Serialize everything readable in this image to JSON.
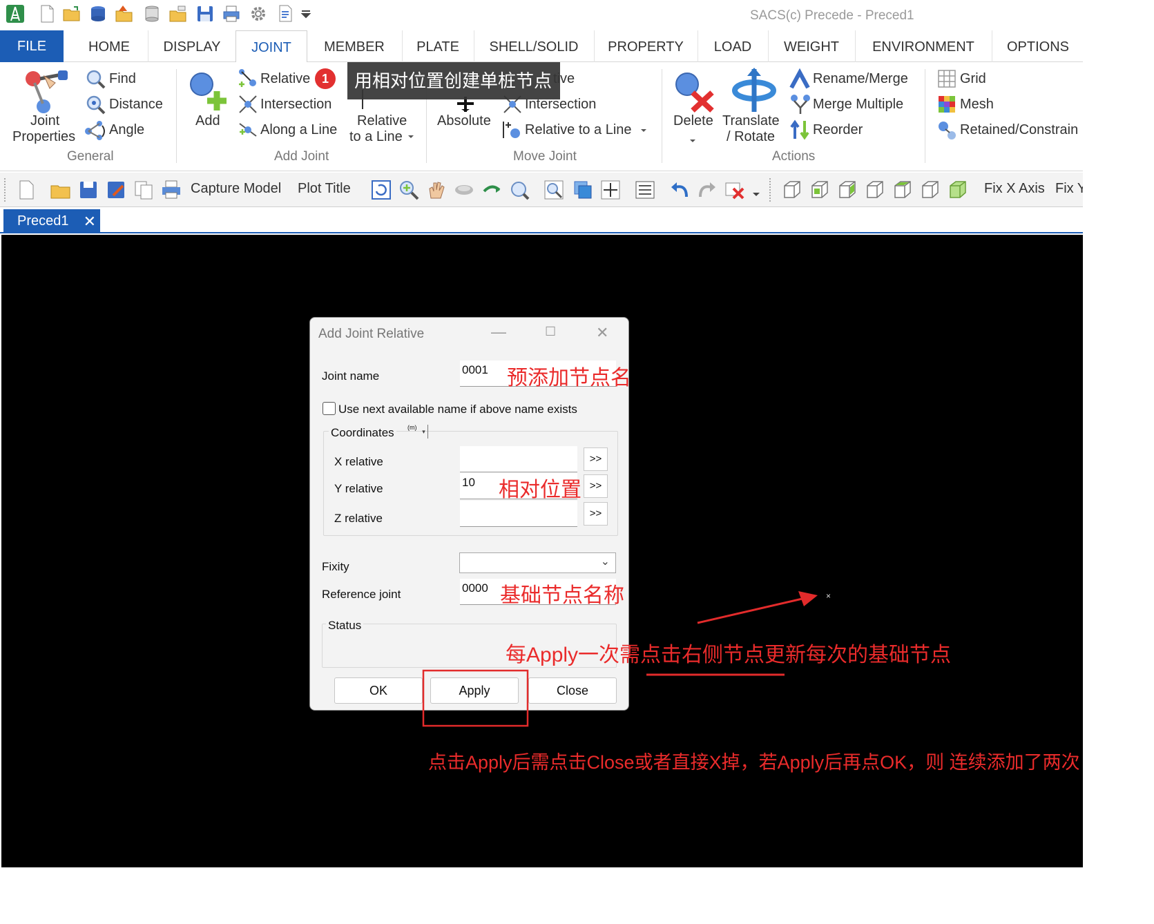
{
  "app": {
    "title": "SACS(c) Precede - Preced1"
  },
  "tabs": [
    "FILE",
    "HOME",
    "DISPLAY",
    "JOINT",
    "MEMBER",
    "PLATE",
    "SHELL/SOLID",
    "PROPERTY",
    "LOAD",
    "WEIGHT",
    "ENVIRONMENT",
    "OPTIONS"
  ],
  "ribbon": {
    "general": {
      "label": "General",
      "joint_properties_1": "Joint",
      "joint_properties_2": "Properties",
      "find": "Find",
      "distance": "Distance",
      "angle": "Angle"
    },
    "add_joint": {
      "label": "Add Joint",
      "add": "Add",
      "relative": "Relative",
      "intersection": "Intersection",
      "along_a_line": "Along a Line",
      "relative_line_1": "Relative",
      "relative_line_2": "to a Line"
    },
    "move_joint": {
      "label": "Move Joint",
      "absolute": "Absolute",
      "relative_partial": "tive",
      "intersection": "Intersection",
      "relative_to_line": "Relative to a Line"
    },
    "actions": {
      "label": "Actions",
      "delete": "Delete",
      "translate_1": "Translate",
      "translate_2": "/ Rotate",
      "rename_merge": "Rename/Merge",
      "merge_multiple": "Merge Multiple",
      "reorder": "Reorder"
    },
    "mesh": {
      "grid": "Grid",
      "mesh": "Mesh",
      "retained": "Retained/Constrain"
    }
  },
  "tooltip": {
    "text": "用相对位置创建单桩节点",
    "badge": "1"
  },
  "toolbar2": {
    "capture_model": "Capture Model",
    "plot_title": "Plot Title",
    "fix_x_axis": "Fix X Axis",
    "fix_y": "Fix Y"
  },
  "document_tab": {
    "label": "Preced1",
    "close": "✕"
  },
  "dialog": {
    "title": "Add Joint Relative",
    "joint_name_label": "Joint name",
    "joint_name_value": "0001",
    "use_next_label": "Use next available name if above name exists",
    "coordinates_label": "Coordinates",
    "unit": "(m)",
    "x_label": "X relative",
    "x_value": "",
    "y_label": "Y relative",
    "y_value": "10",
    "z_label": "Z relative",
    "z_value": "",
    "arrow_btn": ">>",
    "fixity_label": "Fixity",
    "fixity_value": "",
    "reference_joint_label": "Reference joint",
    "reference_joint_value": "0000",
    "status_label": "Status",
    "ok": "OK",
    "apply": "Apply",
    "close": "Close"
  },
  "annotations": {
    "joint_name_note": "预添加节点名",
    "position_note": "相对位置",
    "reference_note": "基础节点名称",
    "apply_note": "每Apply一次需点击右侧节点更新每次的基础节点",
    "close_note": "点击Apply后需点击Close或者直接X掉，若Apply后再点OK，则 连续添加了两次"
  },
  "colors": {
    "accent": "#1c5db5",
    "annotation": "#ea2b2b",
    "canvas": "#000000"
  }
}
